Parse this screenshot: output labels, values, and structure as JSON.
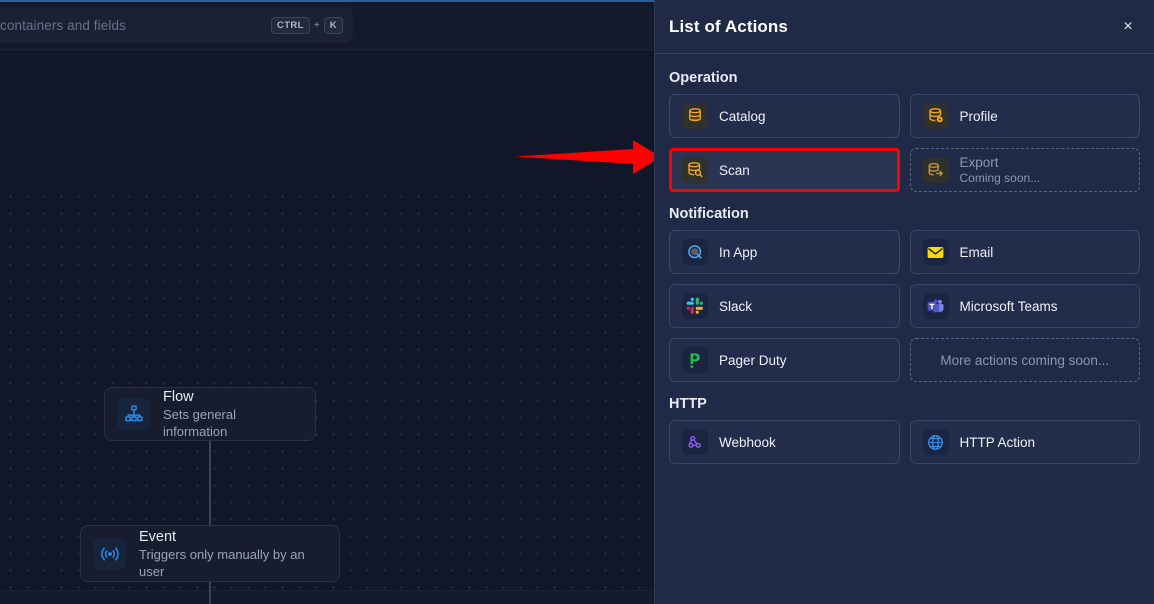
{
  "canvas": {
    "search": {
      "placeholder": "containers and fields",
      "shortcut_key1": "CTRL",
      "shortcut_plus": "+",
      "shortcut_key2": "K"
    },
    "nodes": [
      {
        "title": "Flow",
        "subtitle": "Sets general information",
        "icon": "org-chart-icon"
      },
      {
        "title": "Event",
        "subtitle": "Triggers only manually by an user",
        "icon": "broadcast-icon"
      }
    ],
    "annotation": {
      "type": "red-arrow",
      "color": "#fe0000",
      "points_to": "Scan"
    }
  },
  "panel": {
    "title": "List of Actions",
    "close_label": "×",
    "sections": [
      {
        "title": "Operation",
        "cards": [
          {
            "label": "Catalog",
            "sub": "",
            "icon": "database-icon",
            "icon_style": "dark",
            "state": "normal"
          },
          {
            "label": "Profile",
            "sub": "",
            "icon": "database-gear-icon",
            "icon_style": "dark",
            "state": "normal"
          },
          {
            "label": "Scan",
            "sub": "",
            "icon": "database-search-icon",
            "icon_style": "dark",
            "state": "selected"
          },
          {
            "label": "Export",
            "sub": "Coming soon...",
            "icon": "database-export-icon",
            "icon_style": "dark",
            "state": "disabled"
          }
        ]
      },
      {
        "title": "Notification",
        "cards": [
          {
            "label": "In App",
            "sub": "",
            "icon": "in-app-bubble-icon",
            "icon_style": "navy",
            "state": "normal"
          },
          {
            "label": "Email",
            "sub": "",
            "icon": "envelope-icon",
            "icon_style": "navy",
            "state": "normal"
          },
          {
            "label": "Slack",
            "sub": "",
            "icon": "slack-icon",
            "icon_style": "navy",
            "state": "normal"
          },
          {
            "label": "Microsoft Teams",
            "sub": "",
            "icon": "microsoft-teams-icon",
            "icon_style": "navy",
            "state": "normal"
          },
          {
            "label": "Pager Duty",
            "sub": "",
            "icon": "pagerduty-icon",
            "icon_style": "navy",
            "state": "normal"
          },
          {
            "label": "More actions coming soon...",
            "sub": "",
            "icon": "",
            "icon_style": "",
            "state": "placeholder"
          }
        ]
      },
      {
        "title": "HTTP",
        "cards": [
          {
            "label": "Webhook",
            "sub": "",
            "icon": "webhook-icon",
            "icon_style": "navy",
            "state": "normal"
          },
          {
            "label": "HTTP Action",
            "sub": "",
            "icon": "globe-icon",
            "icon_style": "navy",
            "state": "normal"
          }
        ]
      }
    ]
  },
  "colors": {
    "panel_bg": "#202945",
    "card_bg": "#232d4b",
    "canvas_bg": "#111728",
    "accent_amber": "#f0a81e",
    "accent_blue": "#3b82d9",
    "annotation_red": "#fe0000"
  }
}
